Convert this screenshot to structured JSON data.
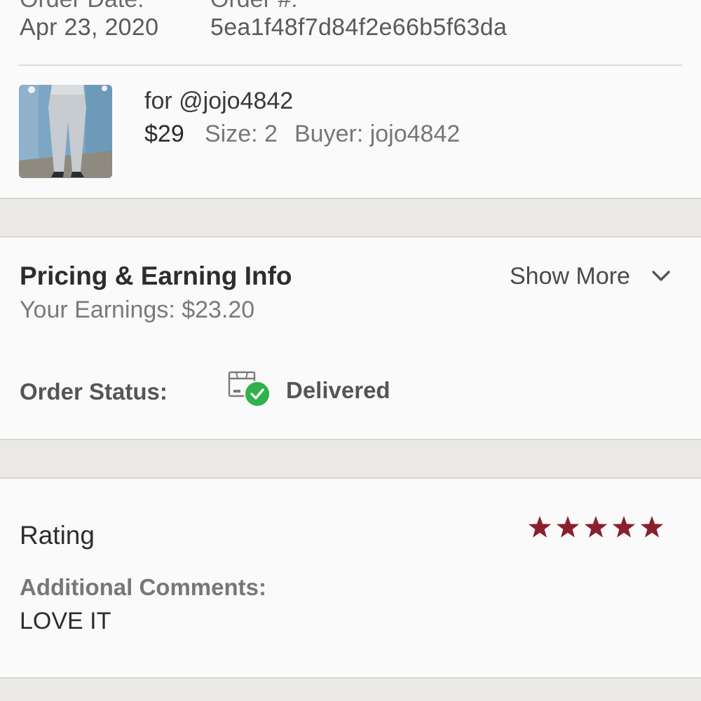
{
  "order": {
    "date_label": "Order Date:",
    "number_label": "Order #:",
    "date": "Apr 23, 2020",
    "number": "5ea1f48f7d84f2e66b5f63da"
  },
  "item": {
    "for_label": "for @jojo4842",
    "price": "$29",
    "size": "Size: 2",
    "buyer": "Buyer: jojo4842"
  },
  "pricing": {
    "title": "Pricing & Earning Info",
    "show_more": "Show More",
    "earnings": "Your Earnings: $23.20"
  },
  "status": {
    "label": "Order Status:",
    "value": "Delivered"
  },
  "rating": {
    "title": "Rating",
    "stars_value": 5,
    "stars_max": 5,
    "star_color": "#8a1f2d",
    "comments_label": "Additional Comments:",
    "comments": "LOVE IT"
  }
}
